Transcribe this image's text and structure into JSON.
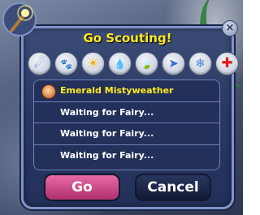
{
  "dialog": {
    "title": "Go Scouting!",
    "close_label": "×"
  },
  "talents": [
    {
      "icon": "light-talent-icon",
      "glyph": "☄",
      "color": "#3a6fd8"
    },
    {
      "icon": "animal-talent-icon",
      "glyph": "🐾",
      "color": "#e07a1a"
    },
    {
      "icon": "sun-talent-icon",
      "glyph": "☀",
      "color": "#f2b51c"
    },
    {
      "icon": "water-talent-icon",
      "glyph": "💧",
      "color": "#3a7ad8"
    },
    {
      "icon": "garden-talent-icon",
      "glyph": "🍃",
      "color": "#3aa040"
    },
    {
      "icon": "fast-flying-talent-icon",
      "glyph": "➤",
      "color": "#3a6fd8"
    },
    {
      "icon": "frost-talent-icon",
      "glyph": "❄",
      "color": "#4a80d8"
    },
    {
      "icon": "healing-talent-icon",
      "glyph": "✚",
      "color": "#e02020"
    }
  ],
  "party": [
    {
      "name": "Emerald Mistyweather",
      "selected": true
    },
    {
      "name": "Waiting for Fairy...",
      "selected": false
    },
    {
      "name": "Waiting for Fairy...",
      "selected": false
    },
    {
      "name": "Waiting for Fairy...",
      "selected": false
    }
  ],
  "buttons": {
    "go_label": "Go",
    "cancel_label": "Cancel"
  }
}
